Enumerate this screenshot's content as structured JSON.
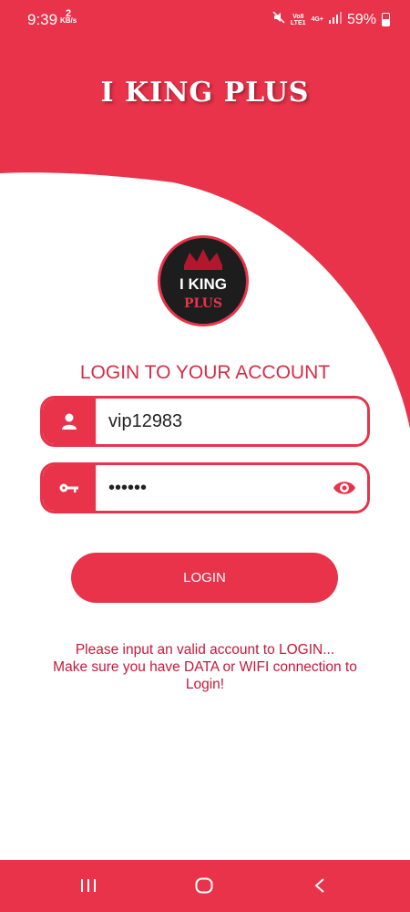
{
  "status_bar": {
    "time": "9:39",
    "data_rate_value": "2",
    "data_rate_unit": "KB/s",
    "network_top": "Vo8",
    "network_bottom": "LTE1",
    "network_type": "4G+",
    "battery": "59%",
    "icons": [
      "mute-icon",
      "signal-icon",
      "battery-icon"
    ]
  },
  "app": {
    "title": "I KING PLUS",
    "logo_text_top": "I KING",
    "logo_text_bottom": "PLUS"
  },
  "login": {
    "heading": "LOGIN TO YOUR ACCOUNT",
    "username_value": "vip12983",
    "password_value": "••••••",
    "button_label": "LOGIN"
  },
  "notice": {
    "line1": "Please input an valid account to LOGIN...",
    "line2": "Make sure you have DATA or WIFI connection to",
    "line3": "Login!"
  },
  "nav": {
    "icons": [
      "recent-apps-icon",
      "home-icon",
      "back-icon"
    ]
  },
  "colors": {
    "accent": "#e8334a",
    "text_red": "#d42d46",
    "white": "#ffffff"
  }
}
